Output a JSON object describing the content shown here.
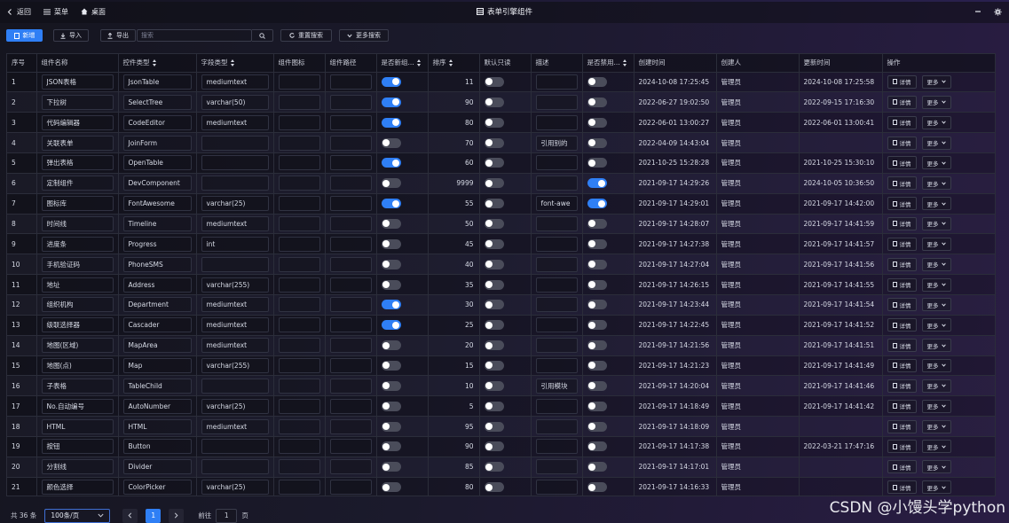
{
  "topbar": {
    "back_label": "返回",
    "menu_label": "菜单",
    "desktop_label": "桌面",
    "title": "表单引擎组件"
  },
  "toolbar": {
    "new_label": "新增",
    "import_label": "导入",
    "export_label": "导出",
    "search_placeholder": "搜索",
    "reset_label": "重置搜索",
    "more_search_label": "更多搜索"
  },
  "table": {
    "headers": [
      "序号",
      "组件名称",
      "控件类型",
      "字段类型",
      "组件图标",
      "组件路径",
      "是否新组...",
      "排序",
      "默认只读",
      "描述",
      "是否禁用...",
      "创建时间",
      "创建人",
      "更新时间",
      "操作"
    ],
    "detail_label": "详情",
    "more_label": "更多",
    "rows": [
      {
        "idx": "1",
        "name": "JSON表格",
        "ctrl": "JsonTable",
        "field": "mediumtext",
        "newc": true,
        "sort": "11",
        "ro": false,
        "desc": "",
        "dis": false,
        "ctime": "2024-10-08 17:25:45",
        "creator": "管理员",
        "utime": "2024-10-08 17:25:58"
      },
      {
        "idx": "2",
        "name": "下拉树",
        "ctrl": "SelectTree",
        "field": "varchar(50)",
        "newc": true,
        "sort": "90",
        "ro": false,
        "desc": "",
        "dis": false,
        "ctime": "2022-06-27 19:02:50",
        "creator": "管理员",
        "utime": "2022-09-15 17:16:30"
      },
      {
        "idx": "3",
        "name": "代码编辑器",
        "ctrl": "CodeEditor",
        "field": "mediumtext",
        "newc": true,
        "sort": "80",
        "ro": false,
        "desc": "",
        "dis": false,
        "ctime": "2022-06-01 13:00:27",
        "creator": "管理员",
        "utime": "2022-06-01 13:00:41"
      },
      {
        "idx": "4",
        "name": "关联表单",
        "ctrl": "JoinForm",
        "field": "",
        "newc": false,
        "sort": "70",
        "ro": false,
        "desc": "引用别的",
        "dis": false,
        "ctime": "2022-04-09 14:43:04",
        "creator": "管理员",
        "utime": ""
      },
      {
        "idx": "5",
        "name": "弹出表格",
        "ctrl": "OpenTable",
        "field": "",
        "newc": true,
        "sort": "60",
        "ro": false,
        "desc": "",
        "dis": false,
        "ctime": "2021-10-25 15:28:28",
        "creator": "管理员",
        "utime": "2021-10-25 15:30:10"
      },
      {
        "idx": "6",
        "name": "定制组件",
        "ctrl": "DevComponent",
        "field": "",
        "newc": false,
        "sort": "9999",
        "ro": false,
        "desc": "",
        "dis": true,
        "ctime": "2021-09-17 14:29:26",
        "creator": "管理员",
        "utime": "2024-10-05 10:36:50"
      },
      {
        "idx": "7",
        "name": "图标库",
        "ctrl": "FontAwesome",
        "field": "varchar(25)",
        "newc": true,
        "sort": "55",
        "ro": false,
        "desc": "font-awe",
        "dis": true,
        "ctime": "2021-09-17 14:29:01",
        "creator": "管理员",
        "utime": "2021-09-17 14:42:00"
      },
      {
        "idx": "8",
        "name": "时间线",
        "ctrl": "Timeline",
        "field": "mediumtext",
        "newc": false,
        "sort": "50",
        "ro": false,
        "desc": "",
        "dis": false,
        "ctime": "2021-09-17 14:28:07",
        "creator": "管理员",
        "utime": "2021-09-17 14:41:59"
      },
      {
        "idx": "9",
        "name": "进度条",
        "ctrl": "Progress",
        "field": "int",
        "newc": false,
        "sort": "45",
        "ro": false,
        "desc": "",
        "dis": false,
        "ctime": "2021-09-17 14:27:38",
        "creator": "管理员",
        "utime": "2021-09-17 14:41:57"
      },
      {
        "idx": "10",
        "name": "手机验证码",
        "ctrl": "PhoneSMS",
        "field": "",
        "newc": false,
        "sort": "40",
        "ro": false,
        "desc": "",
        "dis": false,
        "ctime": "2021-09-17 14:27:04",
        "creator": "管理员",
        "utime": "2021-09-17 14:41:56"
      },
      {
        "idx": "11",
        "name": "地址",
        "ctrl": "Address",
        "field": "varchar(255)",
        "newc": false,
        "sort": "35",
        "ro": false,
        "desc": "",
        "dis": false,
        "ctime": "2021-09-17 14:26:15",
        "creator": "管理员",
        "utime": "2021-09-17 14:41:55"
      },
      {
        "idx": "12",
        "name": "组织机构",
        "ctrl": "Department",
        "field": "mediumtext",
        "newc": true,
        "sort": "30",
        "ro": false,
        "desc": "",
        "dis": false,
        "ctime": "2021-09-17 14:23:44",
        "creator": "管理员",
        "utime": "2021-09-17 14:41:54"
      },
      {
        "idx": "13",
        "name": "级联选择器",
        "ctrl": "Cascader",
        "field": "mediumtext",
        "newc": true,
        "sort": "25",
        "ro": false,
        "desc": "",
        "dis": false,
        "ctime": "2021-09-17 14:22:45",
        "creator": "管理员",
        "utime": "2021-09-17 14:41:52"
      },
      {
        "idx": "14",
        "name": "地图(区域)",
        "ctrl": "MapArea",
        "field": "mediumtext",
        "newc": false,
        "sort": "20",
        "ro": false,
        "desc": "",
        "dis": false,
        "ctime": "2021-09-17 14:21:56",
        "creator": "管理员",
        "utime": "2021-09-17 14:41:51"
      },
      {
        "idx": "15",
        "name": "地图(点)",
        "ctrl": "Map",
        "field": "varchar(255)",
        "newc": false,
        "sort": "15",
        "ro": false,
        "desc": "",
        "dis": false,
        "ctime": "2021-09-17 14:21:23",
        "creator": "管理员",
        "utime": "2021-09-17 14:41:49"
      },
      {
        "idx": "16",
        "name": "子表格",
        "ctrl": "TableChild",
        "field": "",
        "newc": false,
        "sort": "10",
        "ro": false,
        "desc": "引用模块",
        "dis": false,
        "ctime": "2021-09-17 14:20:04",
        "creator": "管理员",
        "utime": "2021-09-17 14:41:46"
      },
      {
        "idx": "17",
        "name": "No.自动编号",
        "ctrl": "AutoNumber",
        "field": "varchar(25)",
        "newc": false,
        "sort": "5",
        "ro": false,
        "desc": "",
        "dis": false,
        "ctime": "2021-09-17 14:18:49",
        "creator": "管理员",
        "utime": "2021-09-17 14:41:42"
      },
      {
        "idx": "18",
        "name": "HTML",
        "ctrl": "HTML",
        "field": "mediumtext",
        "newc": false,
        "sort": "95",
        "ro": false,
        "desc": "",
        "dis": false,
        "ctime": "2021-09-17 14:18:09",
        "creator": "管理员",
        "utime": ""
      },
      {
        "idx": "19",
        "name": "按钮",
        "ctrl": "Button",
        "field": "",
        "newc": false,
        "sort": "90",
        "ro": false,
        "desc": "",
        "dis": false,
        "ctime": "2021-09-17 14:17:38",
        "creator": "管理员",
        "utime": "2022-03-21 17:47:16"
      },
      {
        "idx": "20",
        "name": "分割线",
        "ctrl": "Divider",
        "field": "",
        "newc": false,
        "sort": "85",
        "ro": false,
        "desc": "",
        "dis": false,
        "ctime": "2021-09-17 14:17:01",
        "creator": "管理员",
        "utime": ""
      },
      {
        "idx": "21",
        "name": "颜色选择",
        "ctrl": "ColorPicker",
        "field": "varchar(25)",
        "newc": false,
        "sort": "80",
        "ro": false,
        "desc": "",
        "dis": false,
        "ctime": "2021-09-17 14:16:33",
        "creator": "管理员",
        "utime": ""
      }
    ]
  },
  "footer": {
    "total_label": "共 36 条",
    "page_size_value": "100条/页",
    "current_page": "1",
    "goto_label": "前往",
    "goto_value": "1",
    "page_unit": "页"
  },
  "watermark": "CSDN @小馒头学python",
  "colors": {
    "accent": "#2f7ff5",
    "switch_off": "#4a4c5a"
  }
}
